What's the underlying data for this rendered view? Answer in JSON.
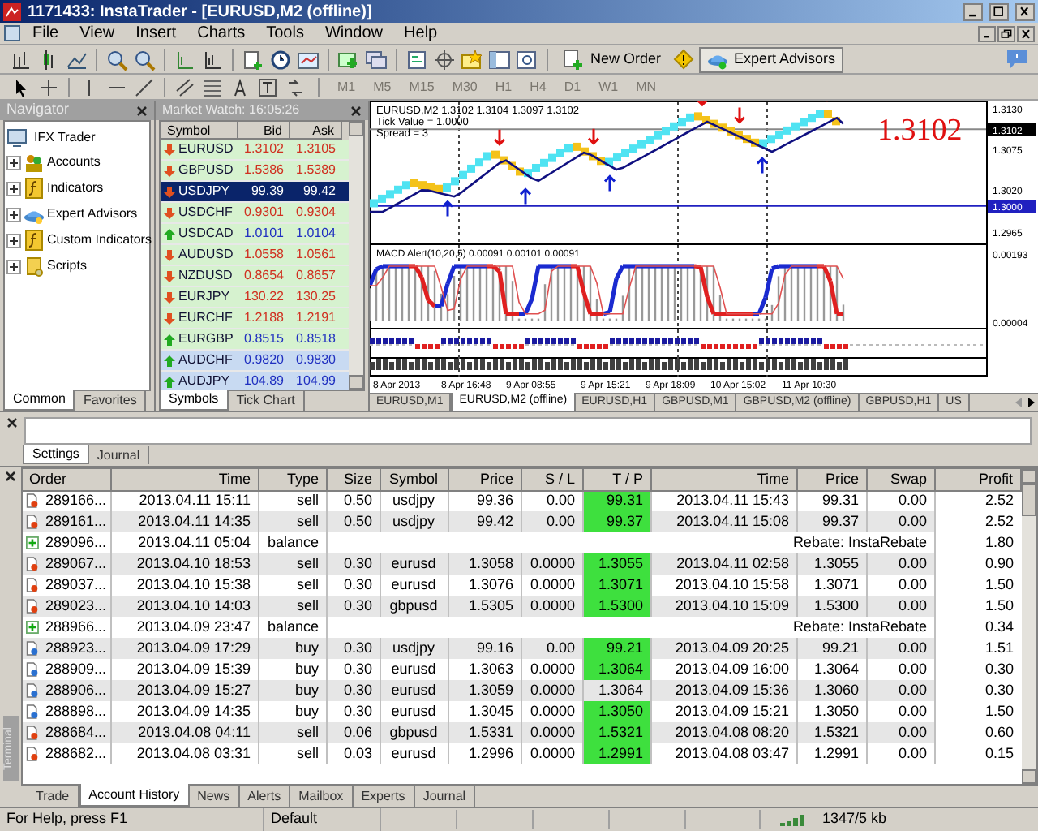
{
  "window": {
    "title": "1171433: InstaTrader - [EURUSD,M2 (offline)]"
  },
  "menu": [
    "File",
    "View",
    "Insert",
    "Charts",
    "Tools",
    "Window",
    "Help"
  ],
  "toolbar": {
    "new_order": "New Order",
    "expert_advisors": "Expert Advisors",
    "expert_advisors_on": true
  },
  "timeframes": [
    {
      "label": "M1",
      "disabled": true
    },
    {
      "label": "M5",
      "disabled": true
    },
    {
      "label": "M15",
      "disabled": true
    },
    {
      "label": "M30",
      "disabled": true
    },
    {
      "label": "H1",
      "disabled": true
    },
    {
      "label": "H4",
      "disabled": true
    },
    {
      "label": "D1",
      "disabled": true
    },
    {
      "label": "W1",
      "disabled": true
    },
    {
      "label": "MN",
      "disabled": true
    }
  ],
  "navigator": {
    "title": "Navigator",
    "root": "IFX Trader",
    "children": [
      {
        "label": "Accounts",
        "kind": "accounts",
        "expanded": false
      },
      {
        "label": "Indicators",
        "kind": "indicators",
        "expanded": false
      },
      {
        "label": "Expert Advisors",
        "kind": "experts",
        "expanded": false
      },
      {
        "label": "Custom Indicators",
        "kind": "custom",
        "expanded": false
      },
      {
        "label": "Scripts",
        "kind": "scripts",
        "expanded": false
      }
    ],
    "tabs": [
      {
        "label": "Common",
        "selected": true
      },
      {
        "label": "Favorites",
        "selected": false
      }
    ]
  },
  "market_watch": {
    "title": "Market Watch: 16:05:26",
    "columns": [
      "Symbol",
      "Bid",
      "Ask"
    ],
    "rows": [
      {
        "symbol": "EURUSD",
        "bid": "1.3102",
        "ask": "1.3105",
        "rising": false,
        "selected": false,
        "highlighted": false
      },
      {
        "symbol": "GBPUSD",
        "bid": "1.5386",
        "ask": "1.5389",
        "rising": false,
        "selected": false,
        "highlighted": false
      },
      {
        "symbol": "USDJPY",
        "bid": "99.39",
        "ask": "99.42",
        "rising": false,
        "selected": true
      },
      {
        "symbol": "USDCHF",
        "bid": "0.9301",
        "ask": "0.9304",
        "rising": false,
        "selected": false,
        "highlighted": false
      },
      {
        "symbol": "USDCAD",
        "bid": "1.0101",
        "ask": "1.0104",
        "rising": true,
        "selected": false,
        "highlighted": false
      },
      {
        "symbol": "AUDUSD",
        "bid": "1.0558",
        "ask": "1.0561",
        "rising": false,
        "selected": false,
        "highlighted": false
      },
      {
        "symbol": "NZDUSD",
        "bid": "0.8654",
        "ask": "0.8657",
        "rising": false,
        "selected": false,
        "highlighted": false
      },
      {
        "symbol": "EURJPY",
        "bid": "130.22",
        "ask": "130.25",
        "rising": false,
        "selected": false,
        "highlighted": false
      },
      {
        "symbol": "EURCHF",
        "bid": "1.2188",
        "ask": "1.2191",
        "rising": false,
        "selected": false,
        "highlighted": false
      },
      {
        "symbol": "EURGBP",
        "bid": "0.8515",
        "ask": "0.8518",
        "rising": true,
        "selected": false,
        "highlighted": false
      },
      {
        "symbol": "AUDCHF",
        "bid": "0.9820",
        "ask": "0.9830",
        "rising": true,
        "selected": false,
        "highlighted": true
      },
      {
        "symbol": "AUDJPY",
        "bid": "104.89",
        "ask": "104.99",
        "rising": true,
        "selected": false,
        "highlighted": true
      }
    ],
    "tabs": [
      {
        "label": "Symbols",
        "selected": true
      },
      {
        "label": "Tick Chart",
        "selected": false
      }
    ]
  },
  "chart": {
    "header": "EURUSD,M2  1.3102 1.3104 1.3097 1.3102",
    "tick_value": "Tick Value = 1.0000",
    "spread": "Spread = 3",
    "big_price": "1.3102",
    "price_labels": [
      {
        "text": "1.3130",
        "kind": "plain"
      },
      {
        "text": "1.3102",
        "kind": "current"
      },
      {
        "text": "1.3075",
        "kind": "plain"
      },
      {
        "text": "1.3020",
        "kind": "plain"
      },
      {
        "text": "1.3000",
        "kind": "line"
      },
      {
        "text": "1.2965",
        "kind": "plain"
      }
    ],
    "indicator": "MACD Alert(10,20,5) 0.00091 0.00101 0.00091",
    "indicator_labels": [
      "0.00193",
      "0.00004"
    ],
    "dates": [
      "8 Apr 2013",
      "8 Apr 16:48",
      "9 Apr 08:55",
      "9 Apr 15:21",
      "9 Apr 18:09",
      "10 Apr 15:02",
      "11 Apr 10:30"
    ],
    "tabs": [
      {
        "label": "EURUSD,M1",
        "selected": false
      },
      {
        "label": "EURUSD,M2 (offline)",
        "selected": true
      },
      {
        "label": "EURUSD,H1",
        "selected": false
      },
      {
        "label": "GBPUSD,M1",
        "selected": false
      },
      {
        "label": "GBPUSD,M2 (offline)",
        "selected": false
      },
      {
        "label": "GBPUSD,H1",
        "selected": false
      },
      {
        "label": "US",
        "selected": false
      }
    ]
  },
  "tester": {
    "tabs": [
      {
        "label": "Settings",
        "selected": true
      },
      {
        "label": "Journal",
        "selected": false
      }
    ]
  },
  "terminal": {
    "title": "Terminal",
    "columns": [
      "Order",
      "Time",
      "Type",
      "Size",
      "Symbol",
      "Price",
      "S / L",
      "T / P",
      "Time",
      "Price",
      "Swap",
      "Profit"
    ],
    "rows": [
      {
        "kind": "sell",
        "order": "289166...",
        "time": "2013.04.11 15:11",
        "type": "sell",
        "size": "0.50",
        "symbol": "usdjpy",
        "price": "99.36",
        "sl": "0.00",
        "tp": "99.31",
        "tp_hit": true,
        "close_time": "2013.04.11 15:43",
        "close_price": "99.31",
        "swap": "0.00",
        "profit": "2.52"
      },
      {
        "kind": "sell",
        "order": "289161...",
        "time": "2013.04.11 14:35",
        "type": "sell",
        "size": "0.50",
        "symbol": "usdjpy",
        "price": "99.42",
        "sl": "0.00",
        "tp": "99.37",
        "tp_hit": true,
        "close_time": "2013.04.11 15:08",
        "close_price": "99.37",
        "swap": "0.00",
        "profit": "2.52"
      },
      {
        "kind": "balance",
        "order": "289096...",
        "time": "2013.04.11 05:04",
        "type": "balance",
        "comment": "Rebate: InstaRebate",
        "profit": "1.80"
      },
      {
        "kind": "sell",
        "order": "289067...",
        "time": "2013.04.10 18:53",
        "type": "sell",
        "size": "0.30",
        "symbol": "eurusd",
        "price": "1.3058",
        "sl": "0.0000",
        "tp": "1.3055",
        "tp_hit": true,
        "close_time": "2013.04.11 02:58",
        "close_price": "1.3055",
        "swap": "0.00",
        "profit": "0.90"
      },
      {
        "kind": "sell",
        "order": "289037...",
        "time": "2013.04.10 15:38",
        "type": "sell",
        "size": "0.30",
        "symbol": "eurusd",
        "price": "1.3076",
        "sl": "0.0000",
        "tp": "1.3071",
        "tp_hit": true,
        "close_time": "2013.04.10 15:58",
        "close_price": "1.3071",
        "swap": "0.00",
        "profit": "1.50"
      },
      {
        "kind": "sell",
        "order": "289023...",
        "time": "2013.04.10 14:03",
        "type": "sell",
        "size": "0.30",
        "symbol": "gbpusd",
        "price": "1.5305",
        "sl": "0.0000",
        "tp": "1.5300",
        "tp_hit": true,
        "close_time": "2013.04.10 15:09",
        "close_price": "1.5300",
        "swap": "0.00",
        "profit": "1.50"
      },
      {
        "kind": "balance",
        "order": "288966...",
        "time": "2013.04.09 23:47",
        "type": "balance",
        "comment": "Rebate: InstaRebate",
        "profit": "0.34"
      },
      {
        "kind": "buy",
        "order": "288923...",
        "time": "2013.04.09 17:29",
        "type": "buy",
        "size": "0.30",
        "symbol": "usdjpy",
        "price": "99.16",
        "sl": "0.00",
        "tp": "99.21",
        "tp_hit": true,
        "close_time": "2013.04.09 20:25",
        "close_price": "99.21",
        "swap": "0.00",
        "profit": "1.51"
      },
      {
        "kind": "buy",
        "order": "288909...",
        "time": "2013.04.09 15:39",
        "type": "buy",
        "size": "0.30",
        "symbol": "eurusd",
        "price": "1.3063",
        "sl": "0.0000",
        "tp": "1.3064",
        "tp_hit": true,
        "close_time": "2013.04.09 16:00",
        "close_price": "1.3064",
        "swap": "0.00",
        "profit": "0.30"
      },
      {
        "kind": "buy",
        "order": "288906...",
        "time": "2013.04.09 15:27",
        "type": "buy",
        "size": "0.30",
        "symbol": "eurusd",
        "price": "1.3059",
        "sl": "0.0000",
        "tp": "1.3064",
        "tp_hit": false,
        "close_time": "2013.04.09 15:36",
        "close_price": "1.3060",
        "swap": "0.00",
        "profit": "0.30"
      },
      {
        "kind": "buy",
        "order": "288898...",
        "time": "2013.04.09 14:35",
        "type": "buy",
        "size": "0.30",
        "symbol": "eurusd",
        "price": "1.3045",
        "sl": "0.0000",
        "tp": "1.3050",
        "tp_hit": true,
        "close_time": "2013.04.09 15:21",
        "close_price": "1.3050",
        "swap": "0.00",
        "profit": "1.50"
      },
      {
        "kind": "sell",
        "order": "288684...",
        "time": "2013.04.08 04:11",
        "type": "sell",
        "size": "0.06",
        "symbol": "gbpusd",
        "price": "1.5331",
        "sl": "0.0000",
        "tp": "1.5321",
        "tp_hit": true,
        "close_time": "2013.04.08 08:20",
        "close_price": "1.5321",
        "swap": "0.00",
        "profit": "0.60"
      },
      {
        "kind": "sell",
        "order": "288682...",
        "time": "2013.04.08 03:31",
        "type": "sell",
        "size": "0.03",
        "symbol": "eurusd",
        "price": "1.2996",
        "sl": "0.0000",
        "tp": "1.2991",
        "tp_hit": true,
        "close_time": "2013.04.08 03:47",
        "close_price": "1.2991",
        "swap": "0.00",
        "profit": "0.15"
      }
    ],
    "tabs": [
      {
        "label": "Trade",
        "selected": false
      },
      {
        "label": "Account History",
        "selected": true
      },
      {
        "label": "News",
        "selected": false
      },
      {
        "label": "Alerts",
        "selected": false
      },
      {
        "label": "Mailbox",
        "selected": false
      },
      {
        "label": "Experts",
        "selected": false
      },
      {
        "label": "Journal",
        "selected": false
      }
    ]
  },
  "status_bar": {
    "help": "For Help, press F1",
    "profile": "Default",
    "traffic": "1347/5 kb"
  }
}
